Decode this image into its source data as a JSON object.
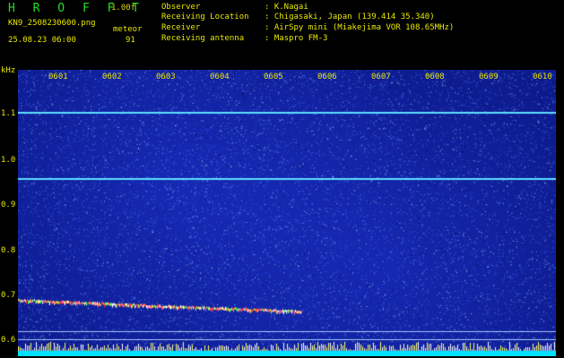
{
  "header": {
    "logo": "H R O F F T",
    "version": "1.00f",
    "filename": "KN9_2508230600.png",
    "meteor_label": "meteor",
    "meteor_count": "91",
    "datetime": "25.08.23 06:00"
  },
  "info": [
    {
      "key": "Observer",
      "value": ": K.Nagai"
    },
    {
      "key": "Receiving Location",
      "value": ": Chigasaki, Japan (139.414 35.340)"
    },
    {
      "key": "Receiver",
      "value": ": AirSpy mini (Miakejima VOR 108.65MHz)"
    },
    {
      "key": "Receiving antenna",
      "value": ": Maspro FM-3"
    }
  ],
  "y_axis": {
    "unit": "kHz",
    "ticks": [
      "1.1",
      "1.0",
      "0.9",
      "0.8",
      "0.7",
      "0.6"
    ]
  },
  "x_axis": {
    "ticks": [
      "0601",
      "0602",
      "0603",
      "0604",
      "0605",
      "0606",
      "0607",
      "0608",
      "0609",
      "0610"
    ]
  },
  "colors": {
    "background": "#0d1a8c",
    "text": "#e8e800",
    "logo": "#22dd22",
    "carrier_line": "#5ce0ff",
    "meteor_trail": "#ff6060",
    "bottom_bar": "#00e0ff"
  },
  "spectrogram": {
    "carriers_khz": [
      1.105,
      0.96,
      0.62,
      0.602
    ],
    "meteor": {
      "start_minute": 0,
      "end_minute": 4.7,
      "start_khz": 0.69,
      "end_khz": 0.665
    }
  }
}
